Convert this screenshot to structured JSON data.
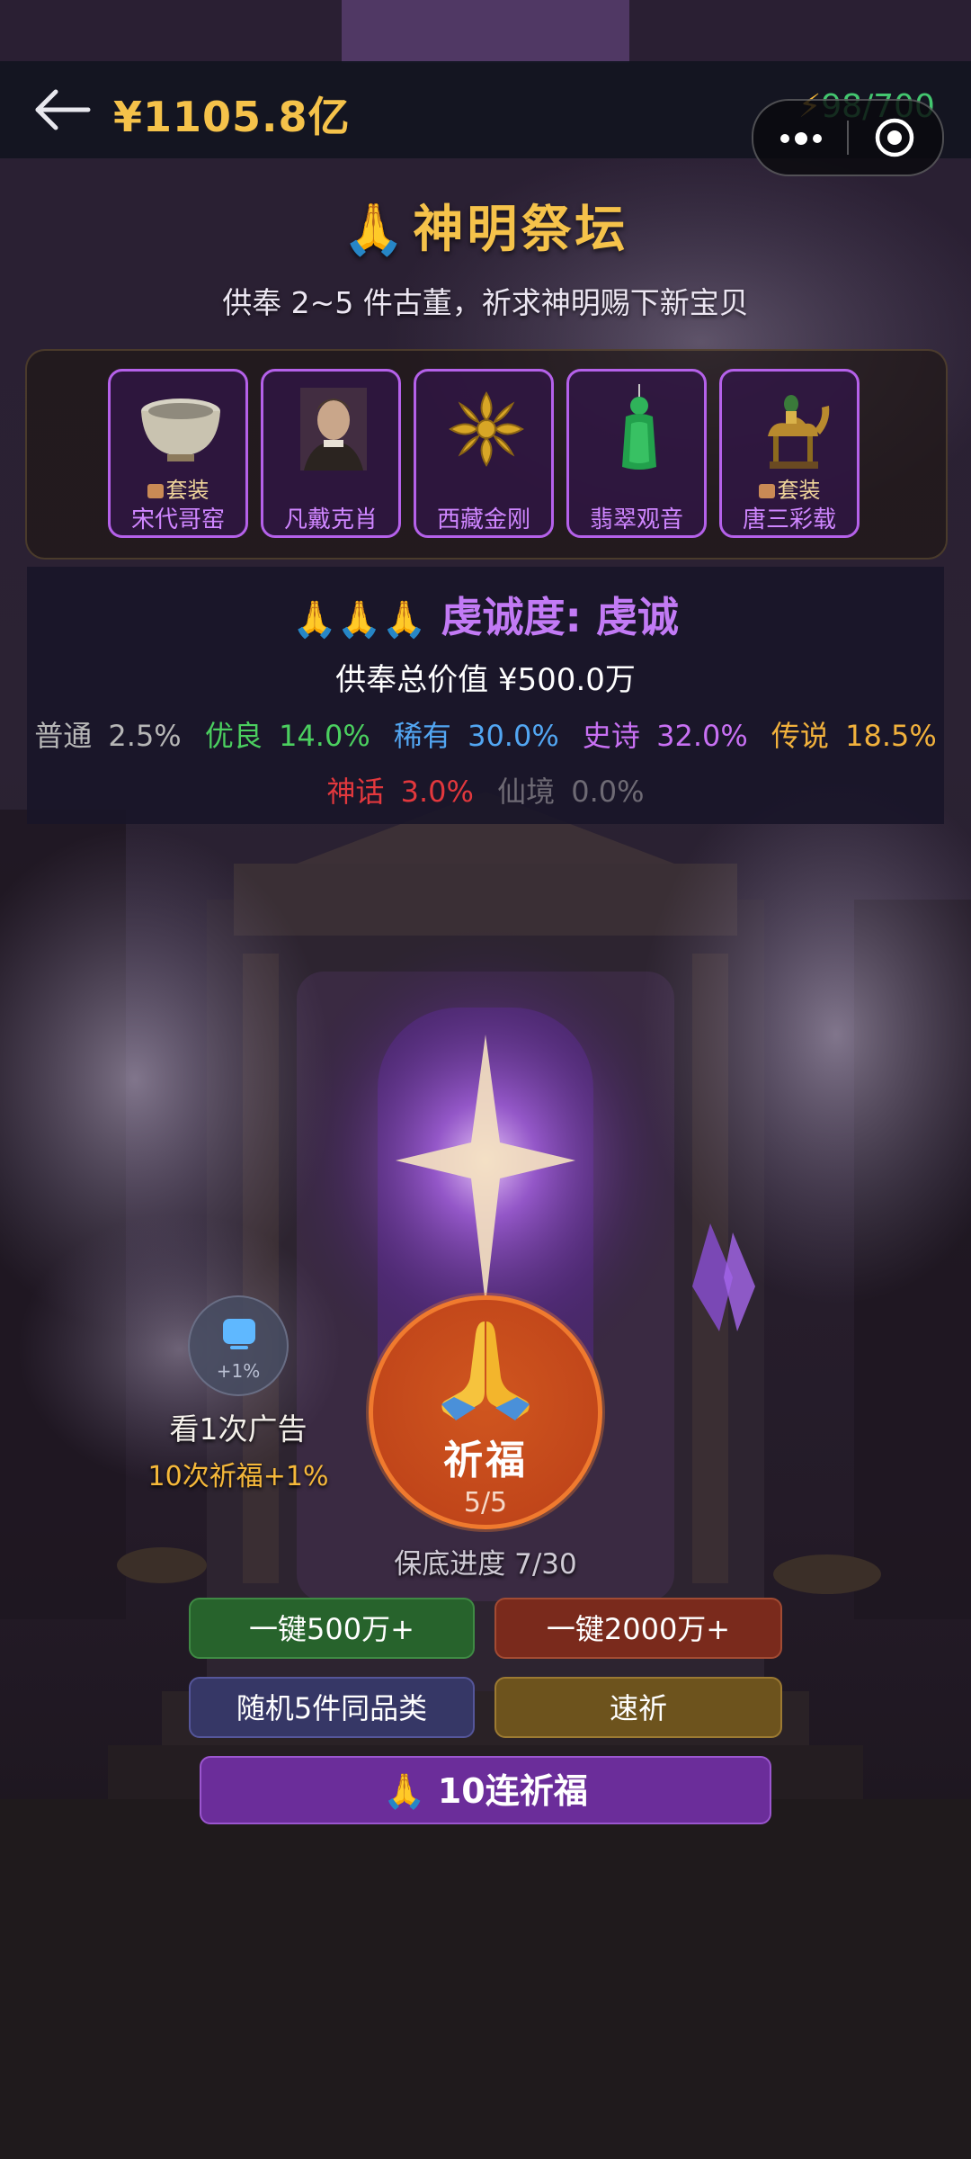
{
  "header": {
    "money": "¥1105.8亿",
    "energy": "98/700",
    "energy_icon": "lightning-icon"
  },
  "title": {
    "icon": "🙏",
    "text": "神明祭坛",
    "subtitle": "供奉 2~5 件古董，祈求神明赐下新宝贝"
  },
  "offerings": [
    {
      "name": "宋代哥窑",
      "tag": "套装",
      "art": "celadon-bowl-icon"
    },
    {
      "name": "凡戴克肖",
      "tag": "",
      "art": "portrait-icon"
    },
    {
      "name": "西藏金刚",
      "tag": "",
      "art": "vajra-icon"
    },
    {
      "name": "翡翠观音",
      "tag": "",
      "art": "jade-guanyin-icon"
    },
    {
      "name": "唐三彩载",
      "tag": "套装",
      "art": "tang-camel-icon"
    }
  ],
  "devotion": {
    "icons": "🙏🙏🙏",
    "label": "虔诚度: 虔诚",
    "total_value": "供奉总价值 ¥500.0万",
    "rates": [
      {
        "name": "普通",
        "value": "2.5%",
        "color": "#b6b6b6"
      },
      {
        "name": "优良",
        "value": "14.0%",
        "color": "#4bcf5f"
      },
      {
        "name": "稀有",
        "value": "30.0%",
        "color": "#52a6f2"
      },
      {
        "name": "史诗",
        "value": "32.0%",
        "color": "#c870f3"
      },
      {
        "name": "传说",
        "value": "18.5%",
        "color": "#f1b13c"
      },
      {
        "name": "神话",
        "value": "3.0%",
        "color": "#e2383d"
      },
      {
        "name": "仙境",
        "value": "0.0%",
        "color": "#6e6a74"
      }
    ]
  },
  "ad": {
    "bonus": "+1%",
    "label": "看1次广告",
    "sub": "10次祈福+1%"
  },
  "pray": {
    "label": "祈福",
    "count": "5/5",
    "pity": "保底进度 7/30"
  },
  "buttons": {
    "one_click_500": "一键500万+",
    "one_click_2000": "一键2000万+",
    "random5": "随机5件同品类",
    "quick": "速祈",
    "ten_icon": "🙏",
    "ten": "10连祈福"
  }
}
